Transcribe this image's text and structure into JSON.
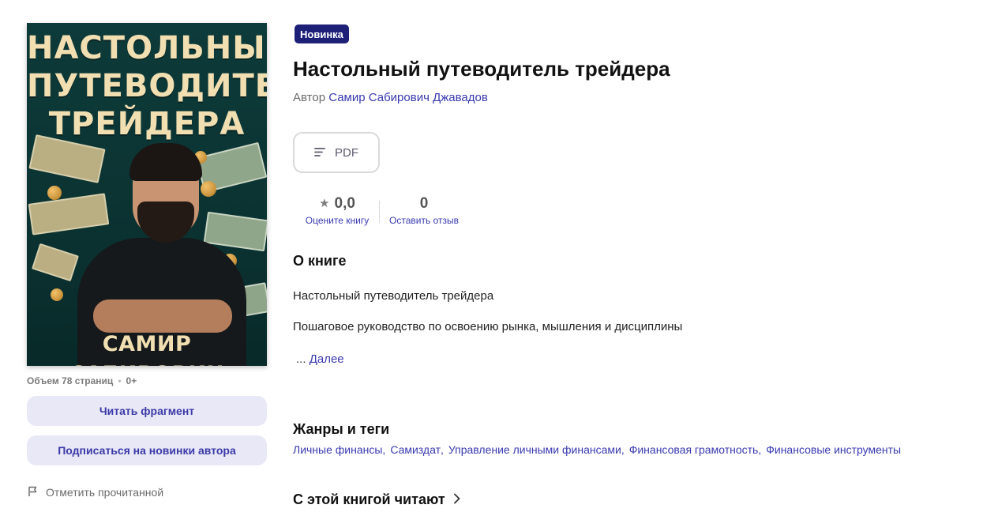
{
  "cover": {
    "title_lines": [
      "НАСТОЛЬНЫЙ",
      "ПУТЕВОДИТЕЛЬ",
      "ТРЕЙДЕРА"
    ],
    "author": "САМИР САБИРОВИЧ"
  },
  "meta": {
    "pages": "Объем 78 страниц",
    "separator": "•",
    "age": "0+"
  },
  "actions": {
    "read_fragment": "Читать фрагмент",
    "subscribe": "Подписаться на новинки автора",
    "mark_read": "Отметить прочитанной"
  },
  "book": {
    "badge": "Новинка",
    "title": "Настольный путеводитель трейдера",
    "author_prefix": "Автор",
    "author_name": "Самир Сабирович Джавадов",
    "format": "PDF"
  },
  "stats": {
    "rating_value": "0,0",
    "rating_label": "Оцените книгу",
    "reviews_value": "0",
    "reviews_label": "Оставить отзыв"
  },
  "about": {
    "heading": "О книге",
    "line1": "Настольный путеводитель трейдера",
    "line2": "Пошаговое руководство по освоению рынка, мышления и дисциплины",
    "more_prefix": "...",
    "more_link": "Далее"
  },
  "genres": {
    "heading": "Жанры и теги",
    "tags": [
      "Личные финансы",
      "Самиздат",
      "Управление личными финансами",
      "Финансовая грамотность",
      "Финансовые инструменты"
    ],
    "separator": ","
  },
  "readers": {
    "heading": "С этой книгой читают"
  },
  "colors": {
    "accent": "#3a3ab0",
    "badge_bg": "#1e2078",
    "button_bg": "#e9e8f6",
    "cover_bg": "#0d3b3a",
    "cover_text": "#f1dfb2"
  }
}
